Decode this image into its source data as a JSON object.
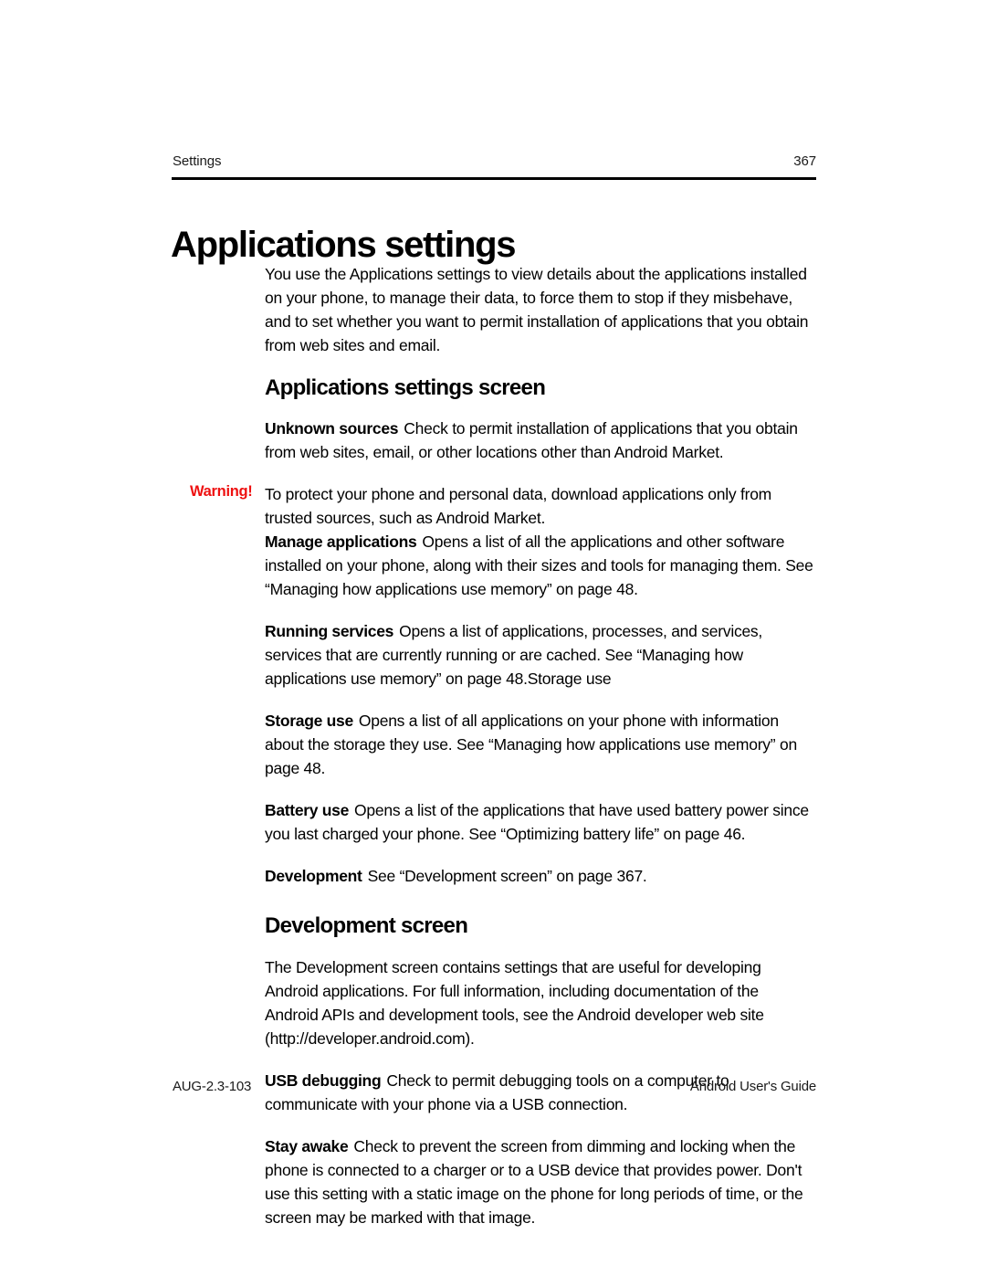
{
  "running_head": {
    "chapter": "Settings",
    "page_number": "367"
  },
  "title": "Applications settings",
  "intro": "You use the Applications settings to view details about the applications installed on your phone, to manage their data, to force them to stop if they misbehave, and to set whether you want to permit installation of applications that you obtain from web sites and email.",
  "sections": [
    {
      "heading": "Applications settings screen",
      "entries": [
        {
          "term": "Unknown sources",
          "text": "Check to permit installation of applications that you obtain from web sites, email, or other locations other than Android Market."
        },
        {
          "margin_label": "Warning!",
          "term": "",
          "text": "To protect your phone and personal data, download applications only from trusted sources, such as Android Market."
        },
        {
          "term": "Manage applications",
          "text": "Opens a list of all the applications and other software installed on your phone, along with their sizes and tools for managing them. See “Managing how applications use memory” on page 48."
        },
        {
          "term": "Running services",
          "text": "Opens a list of applications, processes, and services, services that are currently running or are cached. See “Managing how applications use memory” on page 48.Storage use"
        },
        {
          "term": "Storage use",
          "text": "Opens a list of all applications on your phone with information about the storage they use. See “Managing how applications use memory” on page 48."
        },
        {
          "term": "Battery use",
          "text": "Opens a list of the applications that have used battery power since you last charged your phone. See “Optimizing battery life” on page 46."
        },
        {
          "term": "Development",
          "text": "See “Development screen” on page 367."
        }
      ]
    },
    {
      "heading": "Development screen",
      "intro": "The Development screen contains settings that are useful for developing Android applications. For full information, including documentation of the Android APIs and development tools, see the Android developer web site (http://developer.android.com).",
      "entries": [
        {
          "term": "USB debugging",
          "text": "Check to permit debugging tools on a computer to communicate with your phone via a USB connection."
        },
        {
          "term": "Stay awake",
          "text": "Check to prevent the screen from dimming and locking when the phone is connected to a charger or to a USB device that provides power. Don't use this setting with a static image on the phone for long periods of time, or the screen may be marked with that image."
        }
      ]
    }
  ],
  "footer": {
    "doc_code": "AUG-2.3-103",
    "doc_title": "Android User's Guide"
  },
  "colors": {
    "warning": "#ee1111",
    "text": "#000000",
    "background": "#ffffff"
  }
}
